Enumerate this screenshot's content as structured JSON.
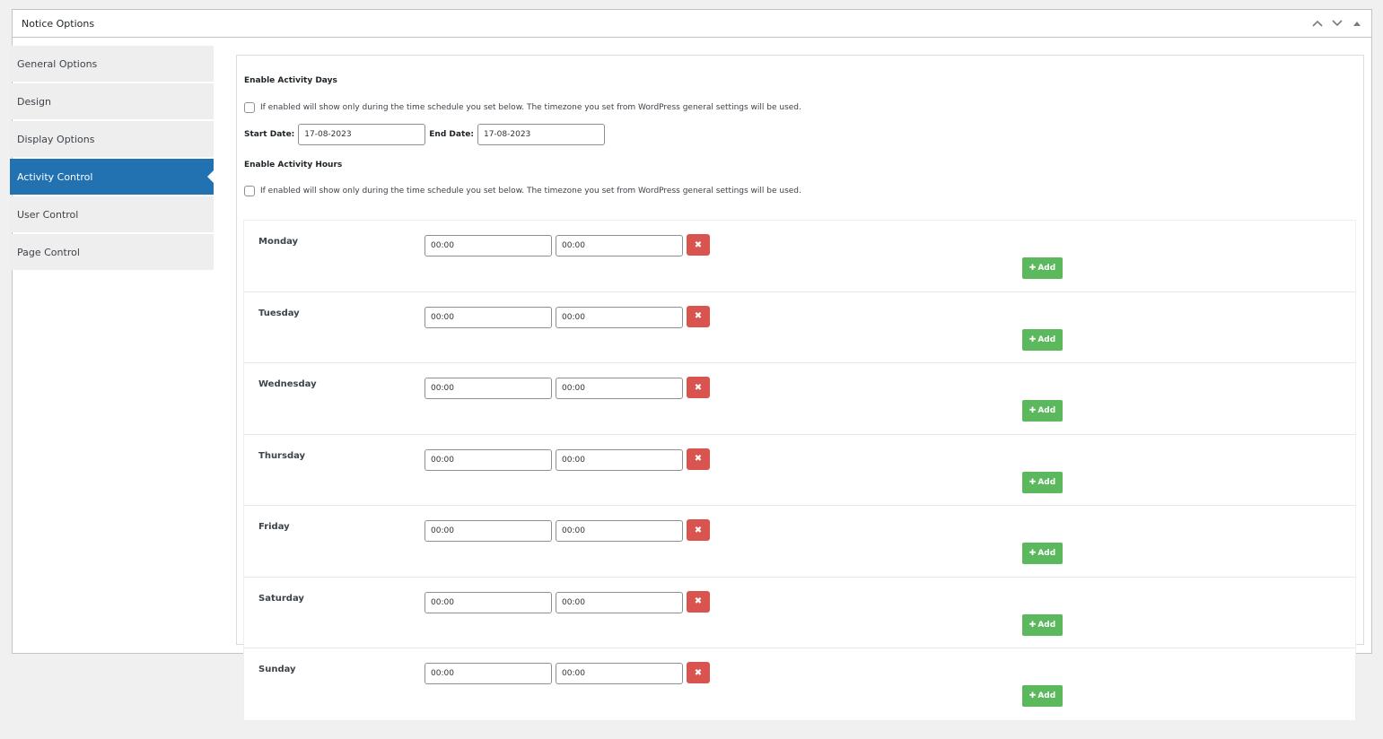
{
  "panel": {
    "title": "Notice Options"
  },
  "sidebar": {
    "items": [
      {
        "label": "General Options"
      },
      {
        "label": "Design"
      },
      {
        "label": "Display Options"
      },
      {
        "label": "Activity Control",
        "active": true
      },
      {
        "label": "User Control"
      },
      {
        "label": "Page Control"
      }
    ]
  },
  "activity_days": {
    "heading": "Enable Activity Days",
    "checkbox_label": "If enabled will show only during the time schedule you set below. The timezone you set from WordPress general settings will be used.",
    "start_label": "Start Date:",
    "start_value": "17-08-2023",
    "end_label": "End Date:",
    "end_value": "17-08-2023"
  },
  "activity_hours": {
    "heading": "Enable Activity Hours",
    "checkbox_label": "If enabled will show only during the time schedule you set below. The timezone you set from WordPress general settings will be used.",
    "add_label": "Add",
    "days": [
      {
        "name": "Monday",
        "start": "00:00",
        "end": "00:00"
      },
      {
        "name": "Tuesday",
        "start": "00:00",
        "end": "00:00"
      },
      {
        "name": "Wednesday",
        "start": "00:00",
        "end": "00:00"
      },
      {
        "name": "Thursday",
        "start": "00:00",
        "end": "00:00"
      },
      {
        "name": "Friday",
        "start": "00:00",
        "end": "00:00"
      },
      {
        "name": "Saturday",
        "start": "00:00",
        "end": "00:00"
      },
      {
        "name": "Sunday",
        "start": "00:00",
        "end": "00:00"
      }
    ]
  },
  "colors": {
    "active_tab": "#2271b1",
    "remove_button": "#d9534f",
    "add_button": "#5cb85c"
  },
  "icons": {
    "move_up": "chevron-up-icon",
    "move_down": "chevron-down-icon",
    "toggle": "caret-up-icon",
    "remove": "close-icon",
    "add": "plus-icon"
  }
}
